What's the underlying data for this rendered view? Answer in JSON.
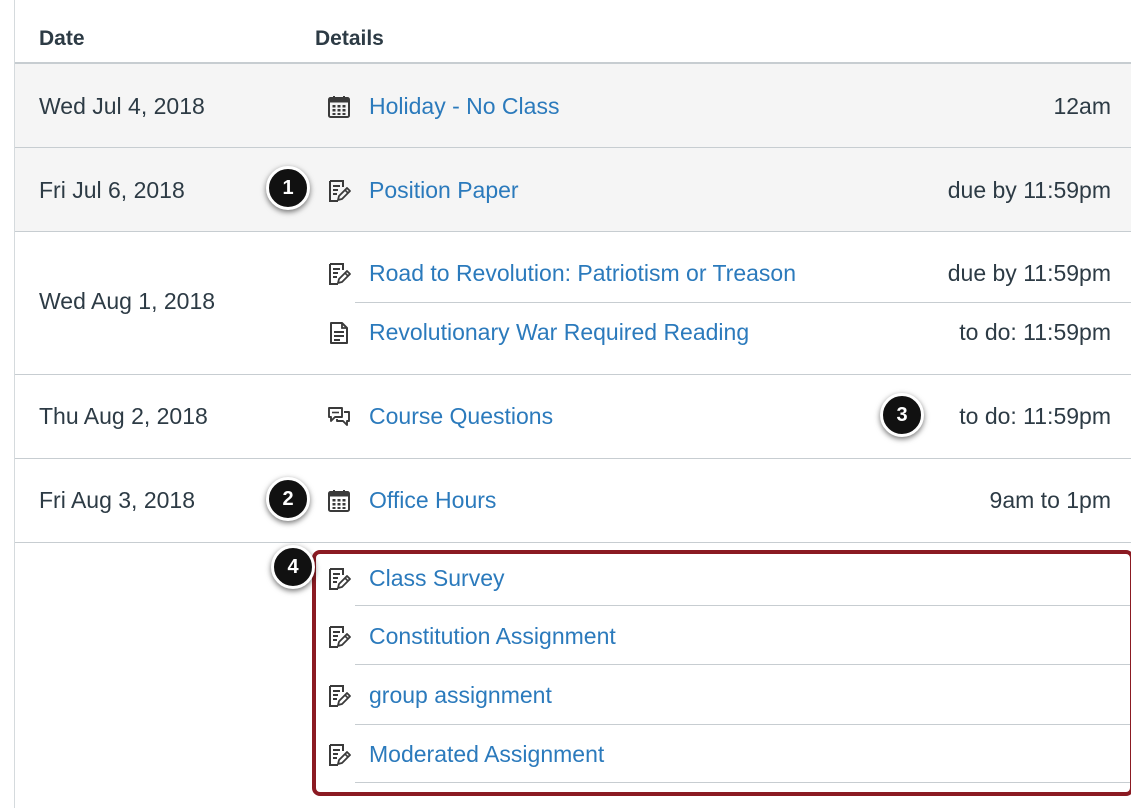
{
  "header": {
    "date_label": "Date",
    "details_label": "Details"
  },
  "colors": {
    "link": "#2b7abc",
    "text": "#2d3b45",
    "highlight": "#8b1a22",
    "badge": "#111111"
  },
  "rows": [
    {
      "date": "Wed Jul 4, 2018",
      "events": [
        {
          "icon": "calendar-icon",
          "title": "Holiday - No Class",
          "time": "12am"
        }
      ]
    },
    {
      "date": "Fri Jul 6, 2018",
      "events": [
        {
          "icon": "assignment-icon",
          "title": "Position Paper",
          "time": "due by 11:59pm"
        }
      ]
    },
    {
      "date": "Wed Aug 1, 2018",
      "events": [
        {
          "icon": "assignment-icon",
          "title": "Road to Revolution: Patriotism or Treason",
          "time": "due by 11:59pm"
        },
        {
          "icon": "page-icon",
          "title": "Revolutionary War Required Reading",
          "time": "to do: 11:59pm"
        }
      ]
    },
    {
      "date": "Thu Aug 2, 2018",
      "events": [
        {
          "icon": "discussion-icon",
          "title": "Course Questions",
          "time": "to do: 11:59pm"
        }
      ]
    },
    {
      "date": "Fri Aug 3, 2018",
      "events": [
        {
          "icon": "calendar-icon",
          "title": "Office Hours",
          "time": "9am to 1pm"
        }
      ]
    },
    {
      "date": "",
      "events": [
        {
          "icon": "assignment-icon",
          "title": "Class Survey"
        },
        {
          "icon": "assignment-icon",
          "title": "Constitution Assignment"
        },
        {
          "icon": "assignment-icon",
          "title": "group assignment"
        },
        {
          "icon": "assignment-icon",
          "title": "Moderated Assignment"
        }
      ]
    }
  ],
  "callouts": [
    "1",
    "2",
    "3",
    "4"
  ]
}
